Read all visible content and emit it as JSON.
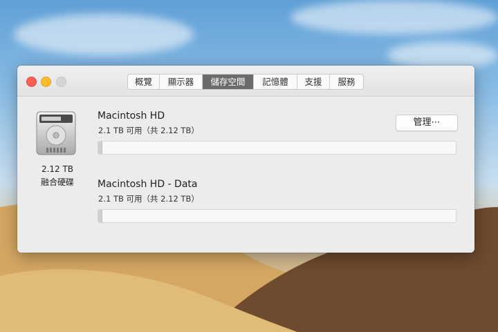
{
  "window": {
    "tabs": [
      {
        "label": "概覽",
        "active": false
      },
      {
        "label": "顯示器",
        "active": false
      },
      {
        "label": "儲存空間",
        "active": true
      },
      {
        "label": "記憶體",
        "active": false
      },
      {
        "label": "支援",
        "active": false
      },
      {
        "label": "服務",
        "active": false
      }
    ]
  },
  "disk": {
    "size": "2.12 TB",
    "type": "融合硬碟"
  },
  "volumes": [
    {
      "name": "Macintosh HD",
      "available": "2.1 TB 可用（共 2.12 TB）",
      "used_fraction": 0.01
    },
    {
      "name": "Macintosh HD - Data",
      "available": "2.1 TB 可用（共 2.12 TB）",
      "used_fraction": 0.01
    }
  ],
  "manage_button": {
    "label": "管理⋯"
  },
  "colors": {
    "active_tab": "#6b6b6b",
    "close": "#fc5f57",
    "minimize": "#fdbc2e"
  }
}
